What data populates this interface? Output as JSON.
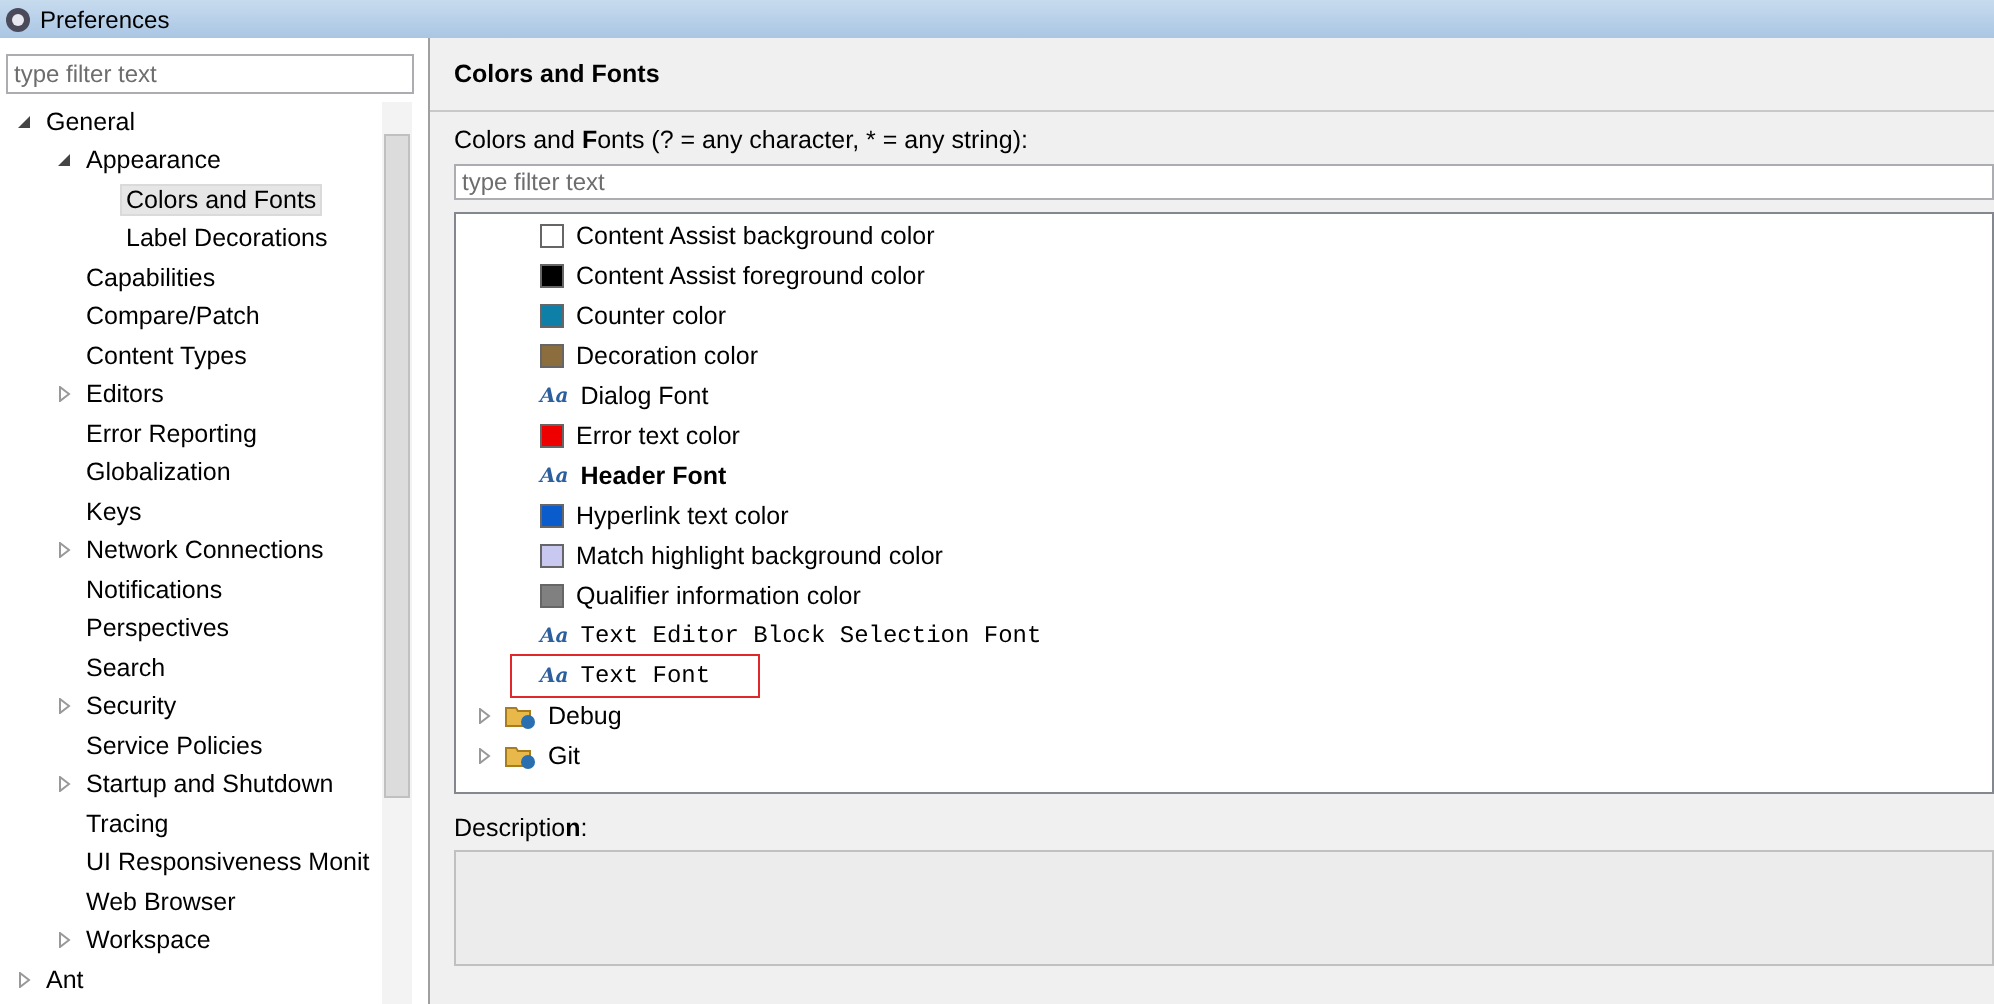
{
  "window": {
    "title": "Preferences"
  },
  "sidebar": {
    "filter": {
      "placeholder": "type filter text"
    },
    "items": [
      {
        "label": "General",
        "expanded": true,
        "selected": false,
        "children": [
          {
            "label": "Appearance",
            "expanded": true,
            "selected": false,
            "children": [
              {
                "label": "Colors and Fonts",
                "selected": true
              },
              {
                "label": "Label Decorations",
                "selected": false
              }
            ]
          },
          {
            "label": "Capabilities",
            "selected": false
          },
          {
            "label": "Compare/Patch",
            "selected": false
          },
          {
            "label": "Content Types",
            "selected": false
          },
          {
            "label": "Editors",
            "expanded": false,
            "selected": false
          },
          {
            "label": "Error Reporting",
            "selected": false
          },
          {
            "label": "Globalization",
            "selected": false
          },
          {
            "label": "Keys",
            "selected": false
          },
          {
            "label": "Network Connections",
            "expanded": false,
            "selected": false
          },
          {
            "label": "Notifications",
            "selected": false
          },
          {
            "label": "Perspectives",
            "selected": false
          },
          {
            "label": "Search",
            "selected": false
          },
          {
            "label": "Security",
            "expanded": false,
            "selected": false
          },
          {
            "label": "Service Policies",
            "selected": false
          },
          {
            "label": "Startup and Shutdown",
            "expanded": false,
            "selected": false
          },
          {
            "label": "Tracing",
            "selected": false
          },
          {
            "label": "UI Responsiveness Monit",
            "selected": false
          },
          {
            "label": "Web Browser",
            "selected": false
          },
          {
            "label": "Workspace",
            "expanded": false,
            "selected": false
          }
        ]
      },
      {
        "label": "Ant",
        "expanded": false,
        "selected": false
      }
    ]
  },
  "page": {
    "title": "Colors and Fonts",
    "filter_label": "Colors and **F**onts (? = any character, * = any string):",
    "filter": {
      "placeholder": "type filter text"
    },
    "items": [
      {
        "kind": "color",
        "label": "Content Assist background color",
        "color": "#ffffff",
        "selected": false
      },
      {
        "kind": "color",
        "label": "Content Assist foreground color",
        "color": "#000000",
        "selected": false
      },
      {
        "kind": "color",
        "label": "Counter color",
        "color": "#0e7fa6",
        "selected": false
      },
      {
        "kind": "color",
        "label": "Decoration color",
        "color": "#8c6e3e",
        "selected": false
      },
      {
        "kind": "font",
        "glyph": "Aa",
        "label": "Dialog Font",
        "selected": false
      },
      {
        "kind": "color",
        "label": "Error text color",
        "color": "#ee0000",
        "selected": false
      },
      {
        "kind": "headerfont",
        "glyph": "Aa",
        "label": "Header Font",
        "selected": false
      },
      {
        "kind": "color",
        "label": "Hyperlink text color",
        "color": "#0a5ccc",
        "selected": false
      },
      {
        "kind": "color",
        "label": "Match highlight background color",
        "color": "#c8c8f0",
        "selected": false
      },
      {
        "kind": "color",
        "label": "Qualifier information color",
        "color": "#808080",
        "selected": false
      },
      {
        "kind": "editorfont",
        "glyph": "Aa",
        "label": "Text Editor Block Selection Font",
        "selected": false
      },
      {
        "kind": "editorfont",
        "glyph": "Aa",
        "label": "Text Font",
        "selected": true
      },
      {
        "kind": "category",
        "label": "Debug",
        "expanded": false,
        "selected": false
      },
      {
        "kind": "category",
        "label": "Git",
        "expanded": false,
        "selected": false
      }
    ],
    "description_label": "Descriptio**n**:"
  }
}
